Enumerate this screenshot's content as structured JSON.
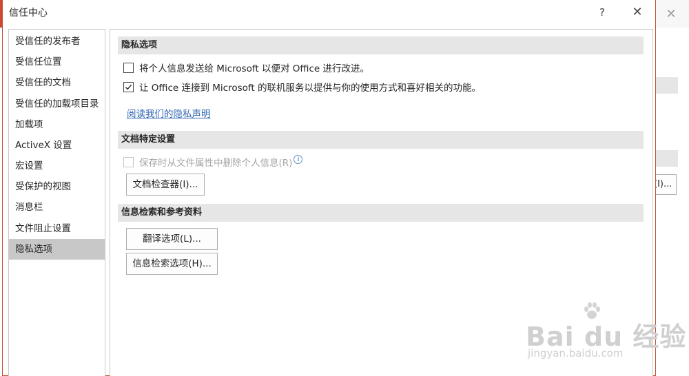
{
  "dialog": {
    "title": "信任中心",
    "help_label": "?",
    "close_label": "✕"
  },
  "nav": {
    "items": [
      {
        "label": "受信任的发布者"
      },
      {
        "label": "受信任位置"
      },
      {
        "label": "受信任的文档"
      },
      {
        "label": "受信任的加载项目录"
      },
      {
        "label": "加载项"
      },
      {
        "label": "ActiveX 设置"
      },
      {
        "label": "宏设置"
      },
      {
        "label": "受保护的视图"
      },
      {
        "label": "消息栏"
      },
      {
        "label": "文件阻止设置"
      },
      {
        "label": "隐私选项",
        "selected": true
      }
    ]
  },
  "privacy": {
    "header": "隐私选项",
    "options": [
      {
        "label": "将个人信息发送给 Microsoft 以便对 Office 进行改进。",
        "checked": false
      },
      {
        "label": "让 Office 连接到 Microsoft 的联机服务以提供与你的使用方式和喜好相关的功能。",
        "checked": true
      }
    ],
    "privacy_link": "阅读我们的隐私声明"
  },
  "document_settings": {
    "header": "文档特定设置",
    "remove_info_option": {
      "label": "保存时从文件属性中删除个人信息(R)",
      "checked": false,
      "disabled": true
    },
    "inspector_button": "文档检查器(I)..."
  },
  "research": {
    "header": "信息检索和参考资料",
    "translation_button": "翻译选项(L)...",
    "research_button": "信息检索选项(H)..."
  },
  "background": {
    "close_label": "✕",
    "button_fragment": "(I)..."
  },
  "watermark": {
    "main": "Bai du 经验",
    "sub": "jingyan.baidu.com"
  },
  "colors": {
    "accent_border": "#c94a2e",
    "link": "#2e63b3",
    "selected_nav": "#c8c8c8",
    "section_header_bg": "#e6e6e6"
  }
}
